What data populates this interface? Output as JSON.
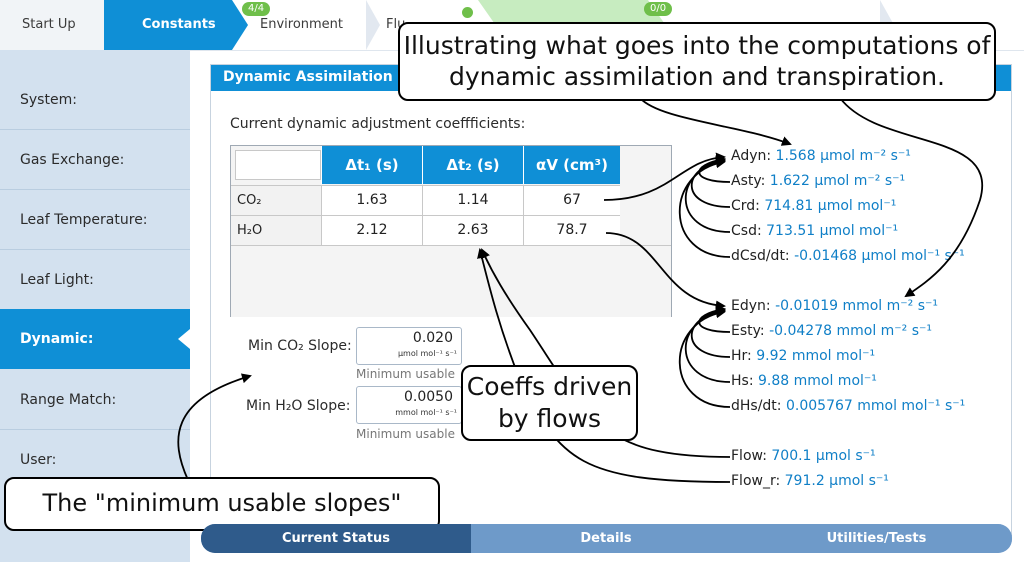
{
  "steps": [
    {
      "label": "Start Up"
    },
    {
      "label": "Constants",
      "active": true
    },
    {
      "label": "Environment",
      "badge": "4/4"
    },
    {
      "label": "Flu"
    },
    {
      "badge": "0/0"
    }
  ],
  "sidebar": {
    "items": [
      {
        "label": "System:"
      },
      {
        "label": "Gas Exchange:"
      },
      {
        "label": "Leaf Temperature:"
      },
      {
        "label": "Leaf Light:"
      },
      {
        "label": "Dynamic:",
        "active": true
      },
      {
        "label": "Range Match:"
      },
      {
        "label": "User:"
      }
    ]
  },
  "panel": {
    "title": "Dynamic Assimilation and",
    "coef_label": "Current dynamic adjustment coeffficients:"
  },
  "table": {
    "headers": [
      "Δt₁ (s)",
      "Δt₂ (s)",
      "αV (cm³)"
    ],
    "rows": [
      {
        "label": "CO₂",
        "values": [
          "1.63",
          "1.14",
          "67"
        ]
      },
      {
        "label": "H₂O",
        "values": [
          "2.12",
          "2.63",
          "78.7"
        ]
      }
    ]
  },
  "slopes": {
    "co2": {
      "label": "Min CO₂ Slope:",
      "value": "0.020",
      "unit": "µmol mol⁻¹ s⁻¹",
      "hint": "Minimum usable"
    },
    "h2o": {
      "label": "Min H₂O Slope:",
      "value": "0.0050",
      "unit": "mmol mol⁻¹ s⁻¹",
      "hint": "Minimum usable"
    }
  },
  "variables": [
    {
      "name": "Adyn:",
      "value": "1.568 µmol m⁻² s⁻¹"
    },
    {
      "name": "Asty:",
      "value": "1.622 µmol m⁻² s⁻¹"
    },
    {
      "name": "Crd:",
      "value": "714.81 µmol mol⁻¹"
    },
    {
      "name": "Csd:",
      "value": "713.51 µmol mol⁻¹"
    },
    {
      "name": "dCsd/dt:",
      "value": "-0.01468 µmol mol⁻¹ s⁻¹"
    },
    {
      "name": "Edyn:",
      "value": "-0.01019 mmol m⁻² s⁻¹"
    },
    {
      "name": "Esty:",
      "value": "-0.04278 mmol m⁻² s⁻¹"
    },
    {
      "name": "Hr:",
      "value": "9.92 mmol mol⁻¹"
    },
    {
      "name": "Hs:",
      "value": "9.88 mmol mol⁻¹"
    },
    {
      "name": "dHs/dt:",
      "value": "0.005767 mmol mol⁻¹ s⁻¹"
    },
    {
      "name": "Flow:",
      "value": "700.1 µmol s⁻¹"
    },
    {
      "name": "Flow_r:",
      "value": "791.2 µmol s⁻¹"
    }
  ],
  "tabs": [
    {
      "label": "Current Status",
      "active": true
    },
    {
      "label": "Details"
    },
    {
      "label": "Utilities/Tests"
    }
  ],
  "callouts": {
    "top_line1": "Illustrating what goes into the computations of",
    "top_line2": "dynamic assimilation and transpiration.",
    "flows_line1": "Coeffs driven",
    "flows_line2": "by flows",
    "slopes": "The \"minimum usable slopes\""
  },
  "colors": {
    "accent": "#0f8fd6",
    "sidebar": "#d3e1ef",
    "value_text": "#0f7fc7",
    "badge": "#6fbf4a"
  }
}
